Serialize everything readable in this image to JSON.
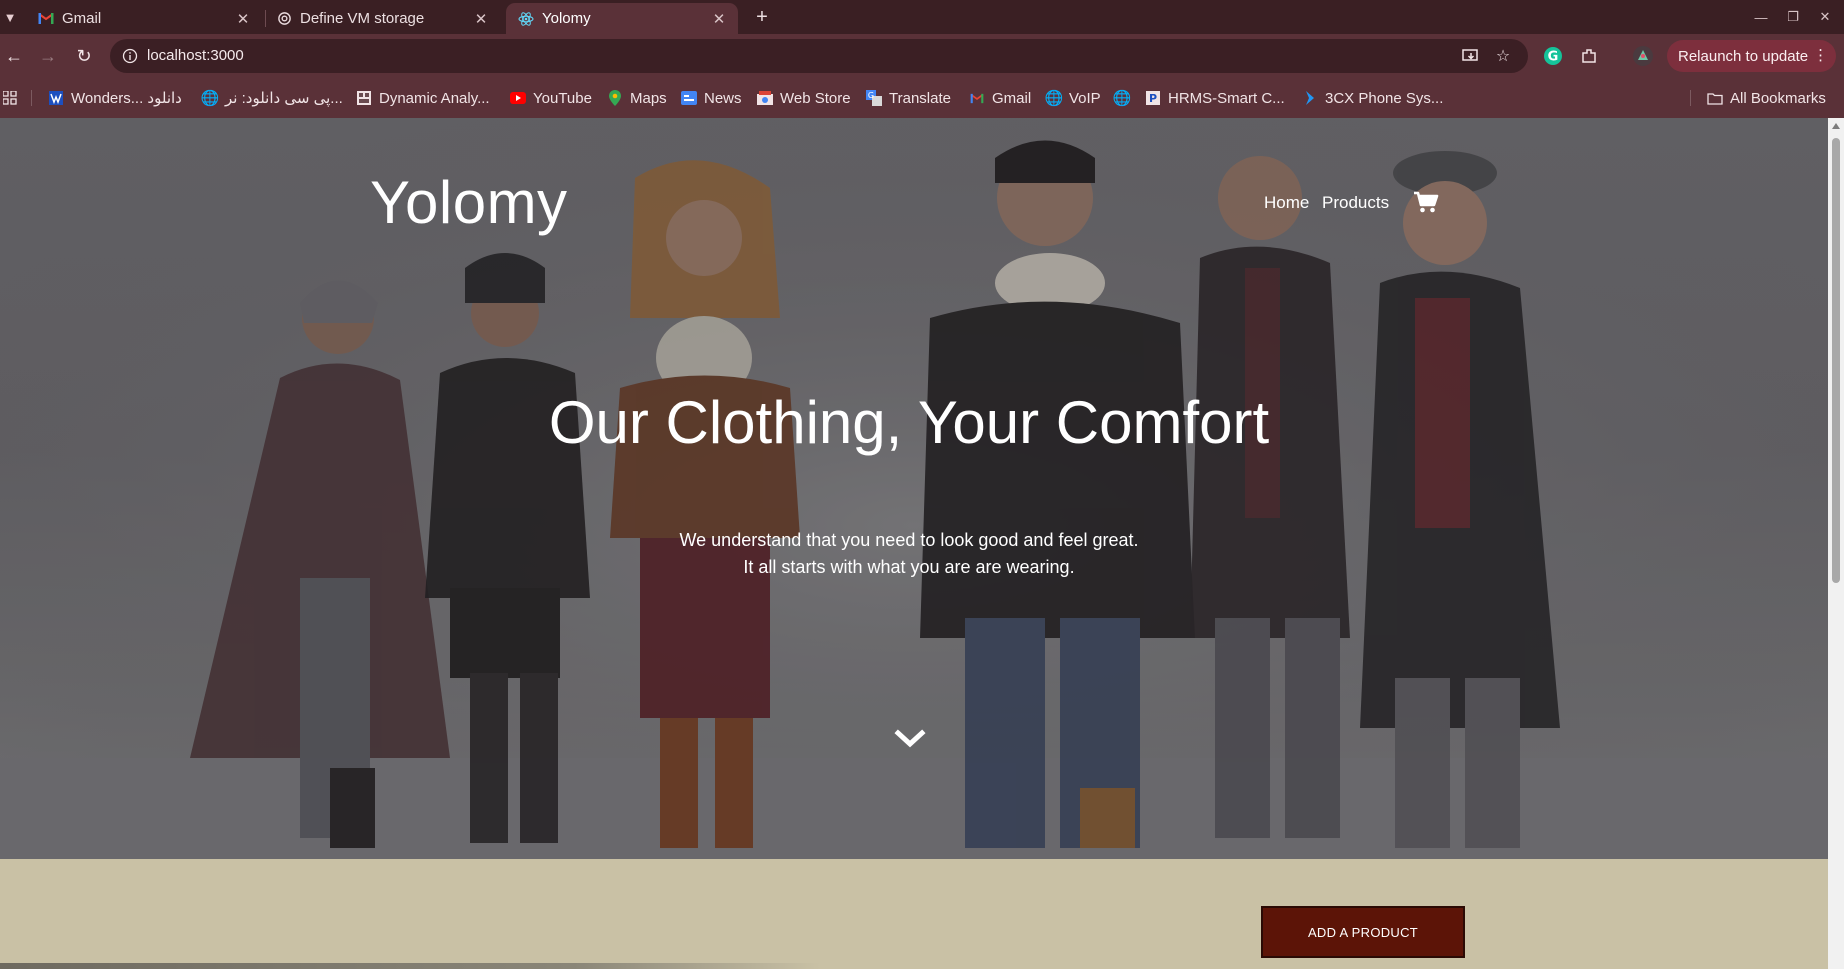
{
  "browser": {
    "tabs": [
      {
        "title": "Gmail",
        "icon": "gmail-icon"
      },
      {
        "title": "Define VM storage",
        "icon": "openai-icon"
      },
      {
        "title": "Yolomy",
        "icon": "react-icon"
      }
    ],
    "url": "localhost:3000",
    "relaunch_label": "Relaunch to update",
    "bookmarks": [
      "Wonders... دانلود",
      "پی سی دانلود: نر...",
      "Dynamic Analy...",
      "YouTube",
      "Maps",
      "News",
      "Web Store",
      "Translate",
      "Gmail",
      "VoIP",
      "",
      "HRMS-Smart C...",
      "3CX Phone Sys..."
    ],
    "all_bookmarks_label": "All Bookmarks"
  },
  "site": {
    "logo": "Yolomy",
    "nav": {
      "home": "Home",
      "products": "Products"
    },
    "hero": {
      "headline": "Our Clothing, Your Comfort",
      "subtitle_line1": "We understand that you need to look good and feel great.",
      "subtitle_line2": "It all starts with what you are are wearing."
    },
    "add_product_label": "ADD A PRODUCT"
  },
  "colors": {
    "tabstrip": "#3a1f23",
    "toolbar": "#5a3138",
    "relaunch": "#7d2f3d",
    "hero_overlay": "#6f6d71",
    "section_bg": "#c9c1a5",
    "add_button": "#5c1407"
  }
}
